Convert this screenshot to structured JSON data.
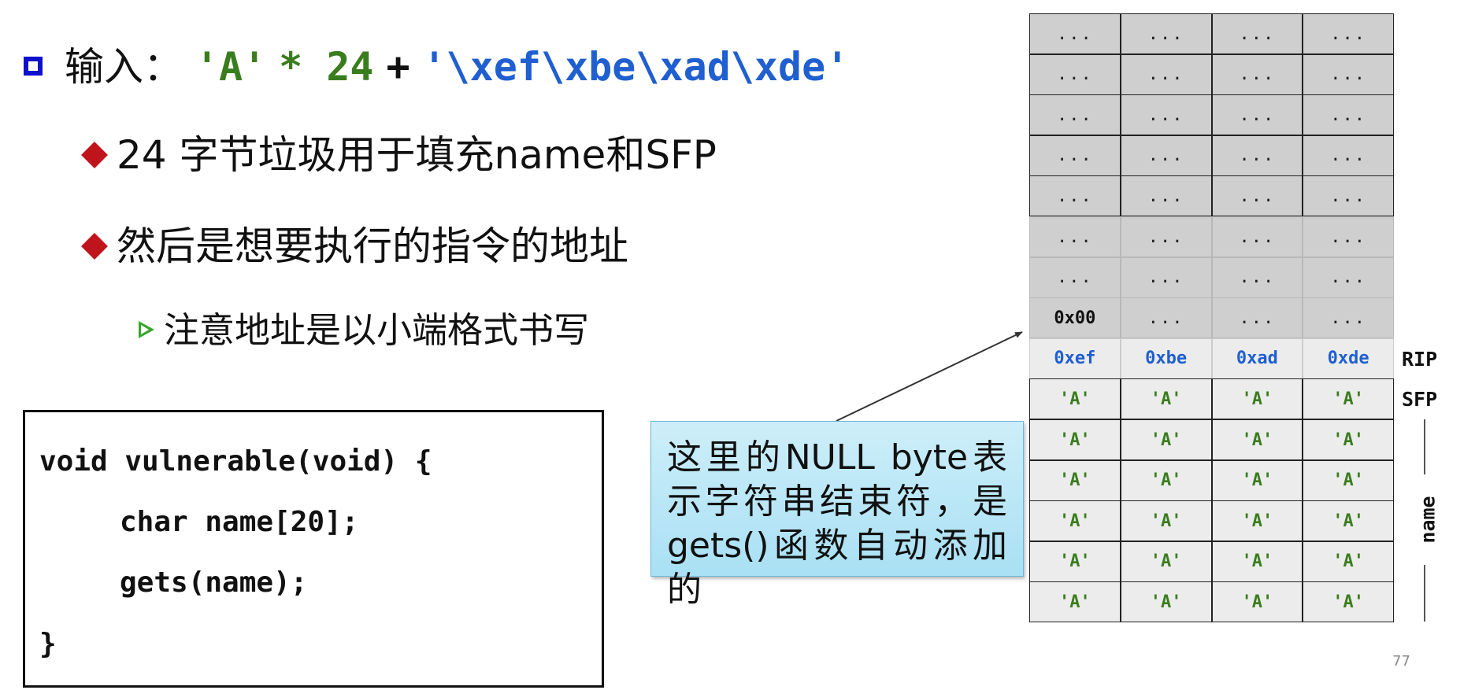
{
  "bullets": {
    "input_label": "输入：",
    "input_part1": "'A'",
    "input_part2": "* 24",
    "input_part3": "+",
    "input_part4": "'\\xef\\xbe\\xad\\xde'",
    "sub1": "24 字节垃圾用于填充name和SFP",
    "sub2": "然后是想要执行的指令的地址",
    "subsub1": "注意地址是以小端格式书写"
  },
  "code": {
    "line1": "void vulnerable(void) {",
    "line2": "char name[20];",
    "line3": "gets(name);",
    "line4": "}"
  },
  "callout": {
    "text": "这里的NULL byte表示字符串结束符，是gets()函数自动添加的"
  },
  "stack": {
    "rows": [
      [
        "...",
        "...",
        "...",
        "..."
      ],
      [
        "...",
        "...",
        "...",
        "..."
      ],
      [
        "...",
        "...",
        "...",
        "..."
      ],
      [
        "...",
        "...",
        "...",
        "..."
      ],
      [
        "...",
        "...",
        "...",
        "..."
      ],
      [
        "...",
        "...",
        "...",
        "..."
      ],
      [
        "...",
        "...",
        "...",
        "..."
      ],
      [
        "0x00",
        "...",
        "...",
        "..."
      ],
      [
        "0xef",
        "0xbe",
        "0xad",
        "0xde"
      ],
      [
        "'A'",
        "'A'",
        "'A'",
        "'A'"
      ],
      [
        "'A'",
        "'A'",
        "'A'",
        "'A'"
      ],
      [
        "'A'",
        "'A'",
        "'A'",
        "'A'"
      ],
      [
        "'A'",
        "'A'",
        "'A'",
        "'A'"
      ],
      [
        "'A'",
        "'A'",
        "'A'",
        "'A'"
      ],
      [
        "'A'",
        "'A'",
        "'A'",
        "'A'"
      ]
    ],
    "label_rip": "RIP",
    "label_sfp": "SFP",
    "label_name": "name"
  },
  "colors": {
    "square_bullet": "#1010cc",
    "diamond_bullet": "#c0141c",
    "arrow_bullet": "#3aa62c",
    "green_text": "#3a7d1e",
    "blue_text": "#1f5fd0",
    "callout_bg": "#a9e0f4",
    "gray_cell": "#cfcfcf"
  },
  "page_number": "77"
}
